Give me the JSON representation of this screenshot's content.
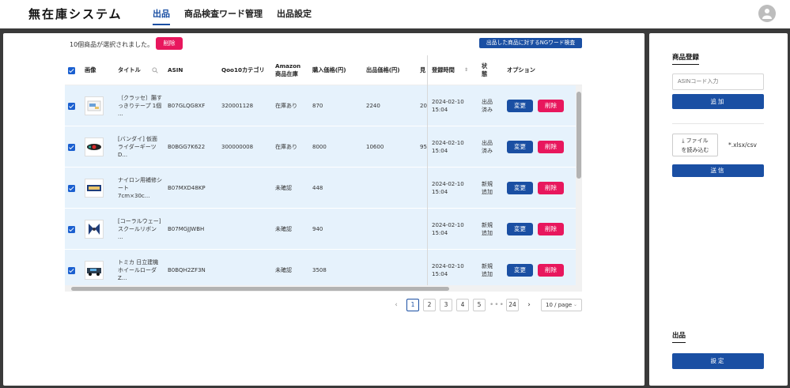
{
  "header": {
    "brand": "無在庫システム",
    "nav": [
      "出品",
      "商品検査ワード管理",
      "出品設定"
    ],
    "active_nav": 0
  },
  "selection": {
    "text": "10個商品が選択されました。",
    "delete_label": "削除",
    "ng_check_label": "出品した商品に対するNGワード検査"
  },
  "table": {
    "headers": {
      "image": "画像",
      "title": "タイトル",
      "asin": "ASIN",
      "qoo10_category": "Qoo10カテゴリ",
      "amazon_stock": "Amazon 商品在庫",
      "purchase_price": "購入価格(円)",
      "sale_price": "出品価格(円)",
      "truncated": "見",
      "registered_at": "登録時間",
      "status": "状態",
      "options": "オプション"
    },
    "edit_label": "変更",
    "delete_label": "削除",
    "rows": [
      {
        "title": "〔クラッセ〕腸すっきりテープ 1個 ...",
        "asin": "B07GLQG8XF",
        "category": "320001128",
        "stock": "在庫あり",
        "purchase": "870",
        "sale": "2240",
        "trunc": "20",
        "date": "2024-02-10",
        "time": "15:04",
        "status": "出品済み",
        "thumb": "box"
      },
      {
        "title": "[バンダイ] 仮面ライダーギーツ D...",
        "asin": "B0BGG7K622",
        "category": "300000008",
        "stock": "在庫あり",
        "purchase": "8000",
        "sale": "10600",
        "trunc": "95",
        "date": "2024-02-10",
        "time": "15:04",
        "status": "出品済み",
        "thumb": "belt"
      },
      {
        "title": "ナイロン用補修シート 7cm×30c...",
        "asin": "B07MXD48KP",
        "category": "",
        "stock": "未確認",
        "purchase": "448",
        "sale": "",
        "trunc": "",
        "date": "2024-02-10",
        "time": "15:04",
        "status": "新規追加",
        "thumb": "sheet"
      },
      {
        "title": "[コーラルウェー] スクールリボン ...",
        "asin": "B07MGJJWBH",
        "category": "",
        "stock": "未確認",
        "purchase": "940",
        "sale": "",
        "trunc": "",
        "date": "2024-02-10",
        "time": "15:04",
        "status": "新規追加",
        "thumb": "ribbon"
      },
      {
        "title": "トミカ 日立建機 ホイールローダ Z...",
        "asin": "B0BQH2ZF3N",
        "category": "",
        "stock": "未確認",
        "purchase": "3508",
        "sale": "",
        "trunc": "",
        "date": "2024-02-10",
        "time": "15:04",
        "status": "新規追加",
        "thumb": "car"
      }
    ]
  },
  "pagination": {
    "pages": [
      "1",
      "2",
      "3",
      "4",
      "5"
    ],
    "ellipsis": "•••",
    "last_page": "24",
    "current": "1",
    "per_page": "10 / page",
    "prev": "‹",
    "next": "›"
  },
  "side": {
    "register_title": "商品登録",
    "asin_placeholder": "ASINコード入力",
    "add_label": "追加",
    "file_label_1": "ファイル",
    "file_label_2": "を読み込む",
    "file_hint": "*.xlsx/csv",
    "send_label": "送信",
    "listing_title": "出品",
    "settings_label": "設定"
  },
  "colors": {
    "accent_blue": "#1a4fa3",
    "danger_pink": "#e8175d",
    "row_selected": "#e6f2fc"
  }
}
